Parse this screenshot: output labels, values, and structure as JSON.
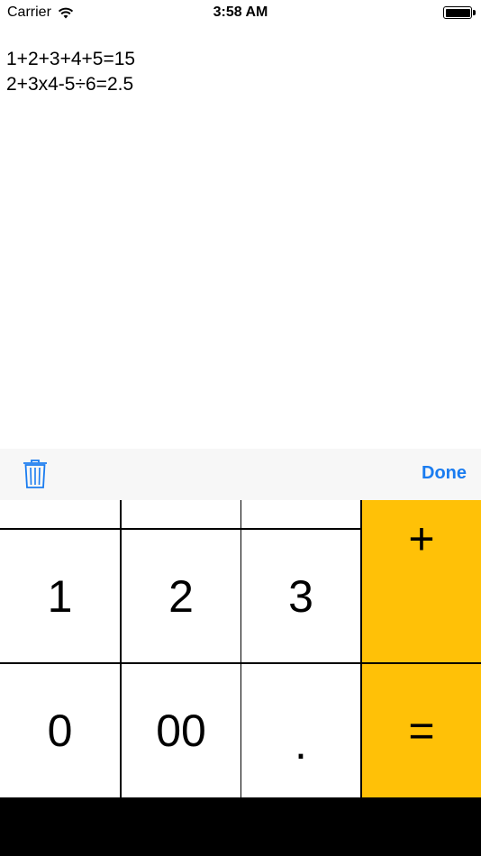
{
  "status_bar": {
    "carrier": "Carrier",
    "time": "3:58 AM"
  },
  "editor": {
    "lines": [
      "1+2+3+4+5=15",
      "2+3x4-5÷6=2.5"
    ]
  },
  "toolbar": {
    "trash_icon": "trash-icon",
    "done_label": "Done"
  },
  "keypad": {
    "row3": [
      "1",
      "2",
      "3"
    ],
    "plus": "+",
    "row4": [
      "0",
      "00",
      "."
    ],
    "equals": "="
  },
  "colors": {
    "accent": "#1a7cf0",
    "operator": "#ffc107"
  }
}
